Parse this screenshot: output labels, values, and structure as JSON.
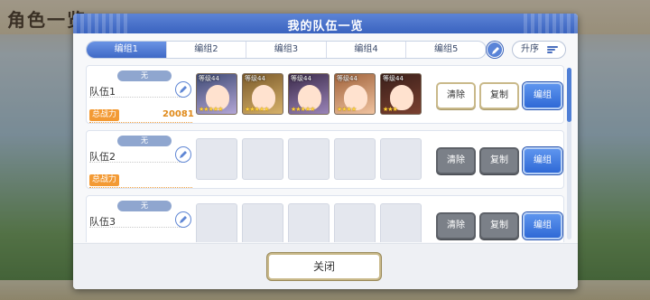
{
  "background": {
    "screen_title": "角色一览"
  },
  "dialog": {
    "title": "我的队伍一览",
    "tabs": [
      {
        "label": "编组1",
        "active": true
      },
      {
        "label": "编组2",
        "active": false
      },
      {
        "label": "编组3",
        "active": false
      },
      {
        "label": "编组4",
        "active": false
      },
      {
        "label": "编组5",
        "active": false
      }
    ],
    "sort_label": "升序",
    "close_label": "关闭"
  },
  "teams": [
    {
      "tag": "无",
      "name": "队伍1",
      "power_label": "总战力",
      "power_value": "20081",
      "clear_label": "清除",
      "copy_label": "复制",
      "edit_label": "编组",
      "members": [
        {
          "level": "等级44",
          "stars": "★★★★★",
          "colors": [
            "#3e4a74",
            "#b3a6d6"
          ]
        },
        {
          "level": "等级44",
          "stars": "★★★★★",
          "colors": [
            "#7b5a2a",
            "#d6b16a"
          ]
        },
        {
          "level": "等级44",
          "stars": "★★★★★",
          "colors": [
            "#3b2a4a",
            "#9a84b8"
          ]
        },
        {
          "level": "等级44",
          "stars": "★★★★",
          "colors": [
            "#a0623a",
            "#f0c3a0"
          ]
        },
        {
          "level": "等级44",
          "stars": "★★★",
          "colors": [
            "#3a1f1a",
            "#7a4030"
          ]
        }
      ]
    },
    {
      "tag": "无",
      "name": "队伍2",
      "power_label": "总战力",
      "power_value": "",
      "clear_label": "清除",
      "copy_label": "复制",
      "edit_label": "编组",
      "members": []
    },
    {
      "tag": "无",
      "name": "队伍3",
      "power_label": "",
      "power_value": "",
      "clear_label": "清除",
      "copy_label": "复制",
      "edit_label": "编组",
      "members": []
    }
  ]
}
